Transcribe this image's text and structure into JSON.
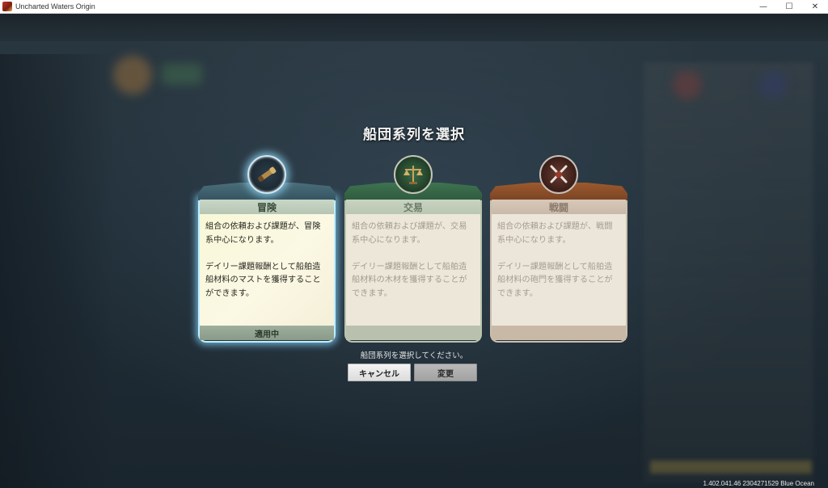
{
  "window": {
    "title": "Uncharted Waters Origin",
    "controls": {
      "minimize": "—",
      "maximize": "☐",
      "close": "✕"
    }
  },
  "dialog": {
    "title": "船団系列を選択",
    "hint": "船団系列を選択してください。",
    "cancel_label": "キャンセル",
    "change_label": "変更"
  },
  "cards": [
    {
      "id": "adventure",
      "name": "冒険",
      "line1": "組合の依頼および課題が、冒険系中心になります。",
      "line2": "デイリー課題報酬として船舶造船材料のマストを獲得することができます。",
      "status": "適用中",
      "selected": true,
      "icon": "spyglass-icon",
      "accent": "#355361"
    },
    {
      "id": "trade",
      "name": "交易",
      "line1": "組合の依頼および課題が、交易系中心になります。",
      "line2": "デイリー課題報酬として船舶造船材料の木材を獲得することができます。",
      "status": "",
      "selected": false,
      "icon": "scales-icon",
      "accent": "#2f5b3e"
    },
    {
      "id": "battle",
      "name": "戦闘",
      "line1": "組合の依頼および課題が、戦闘系中心になります。",
      "line2": "デイリー課題報酬として船舶造船材料の砲門を獲得することができます。",
      "status": "",
      "selected": false,
      "icon": "crossed-swords-icon",
      "accent": "#7a4424"
    }
  ],
  "version": "1.402.041.46 2304271529 Blue Ocean"
}
